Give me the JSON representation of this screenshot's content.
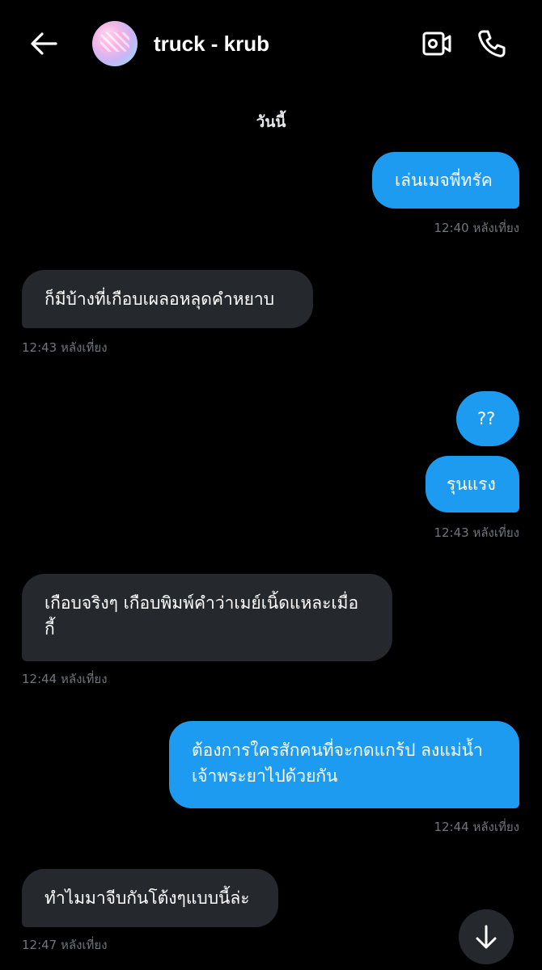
{
  "header": {
    "back_icon": "arrow-left-icon",
    "title": "truck - krub",
    "video_icon": "video-camera-icon",
    "call_icon": "phone-icon"
  },
  "date_divider": "วันนี้",
  "messages": [
    {
      "direction": "out",
      "text": "เล่นเมจพี่ทรัค",
      "time": "12:40 หลังเที่ยง"
    },
    {
      "direction": "in",
      "text": "ก็มีบ้างที่เกือบเผลอหลุดคำหยาบ",
      "time": "12:43 หลังเที่ยง"
    },
    {
      "direction": "out",
      "text": "??",
      "time": ""
    },
    {
      "direction": "out",
      "text": "รุนแรง",
      "time": "12:43 หลังเที่ยง"
    },
    {
      "direction": "in",
      "lines": [
        "เกือบจริงๆ เกือบพิมพ์คำว่าเมย์เนิ้ดแหละเมื่อ",
        "กี้"
      ],
      "time": "12:44 หลังเที่ยง"
    },
    {
      "direction": "out",
      "lines": [
        "ต้องการใครสักคนที่จะกดแกร้ป ลงแม่น้ำ",
        "เจ้าพระยาไปด้วยกัน"
      ],
      "time": "12:44 หลังเที่ยง"
    },
    {
      "direction": "in",
      "text": "ทำไมมาจีบกันโต้งๆแบบนี้ล่ะ",
      "time": "12:47 หลังเที่ยง"
    }
  ],
  "scroll_button_icon": "arrow-down-icon",
  "colors": {
    "background": "#000000",
    "outgoing_bubble": "#1d9bf0",
    "incoming_bubble": "#25292e",
    "timestamp": "#71767b"
  }
}
